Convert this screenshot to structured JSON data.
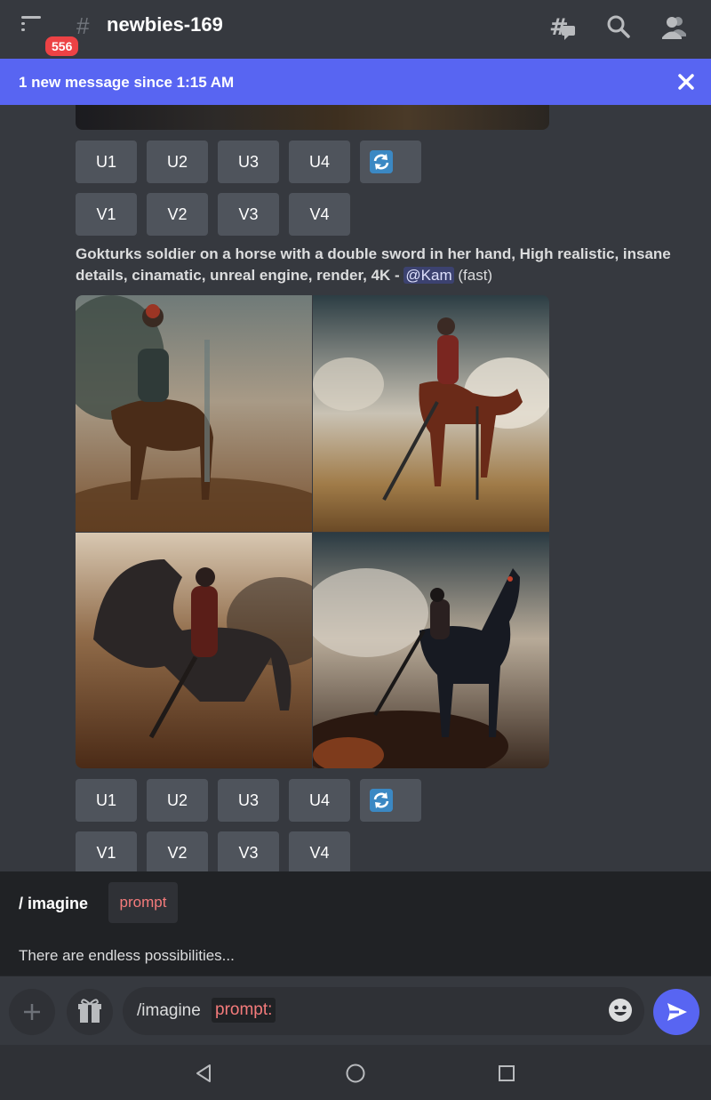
{
  "header": {
    "unread_count": "556",
    "channel_name": "newbies-169"
  },
  "banner": {
    "text": "1 new message since 1:15 AM"
  },
  "buttons_row1": [
    "U1",
    "U2",
    "U3",
    "U4"
  ],
  "buttons_row2": [
    "V1",
    "V2",
    "V3",
    "V4"
  ],
  "message": {
    "prompt": "Gokturks soldier on a horse with a double sword in her hand, High realistic, insane details, cinamatic, unreal engine, render, 4K - ",
    "mention": "@Kam",
    "speed": "(fast)"
  },
  "command": {
    "name": "/ imagine",
    "option": "prompt",
    "description": "There are endless possibilities..."
  },
  "input": {
    "command_text": "/imagine",
    "param_text": "prompt:"
  },
  "colors": {
    "accent": "#5865f2",
    "badge": "#ed4245",
    "refresh": "#3b88c3"
  }
}
